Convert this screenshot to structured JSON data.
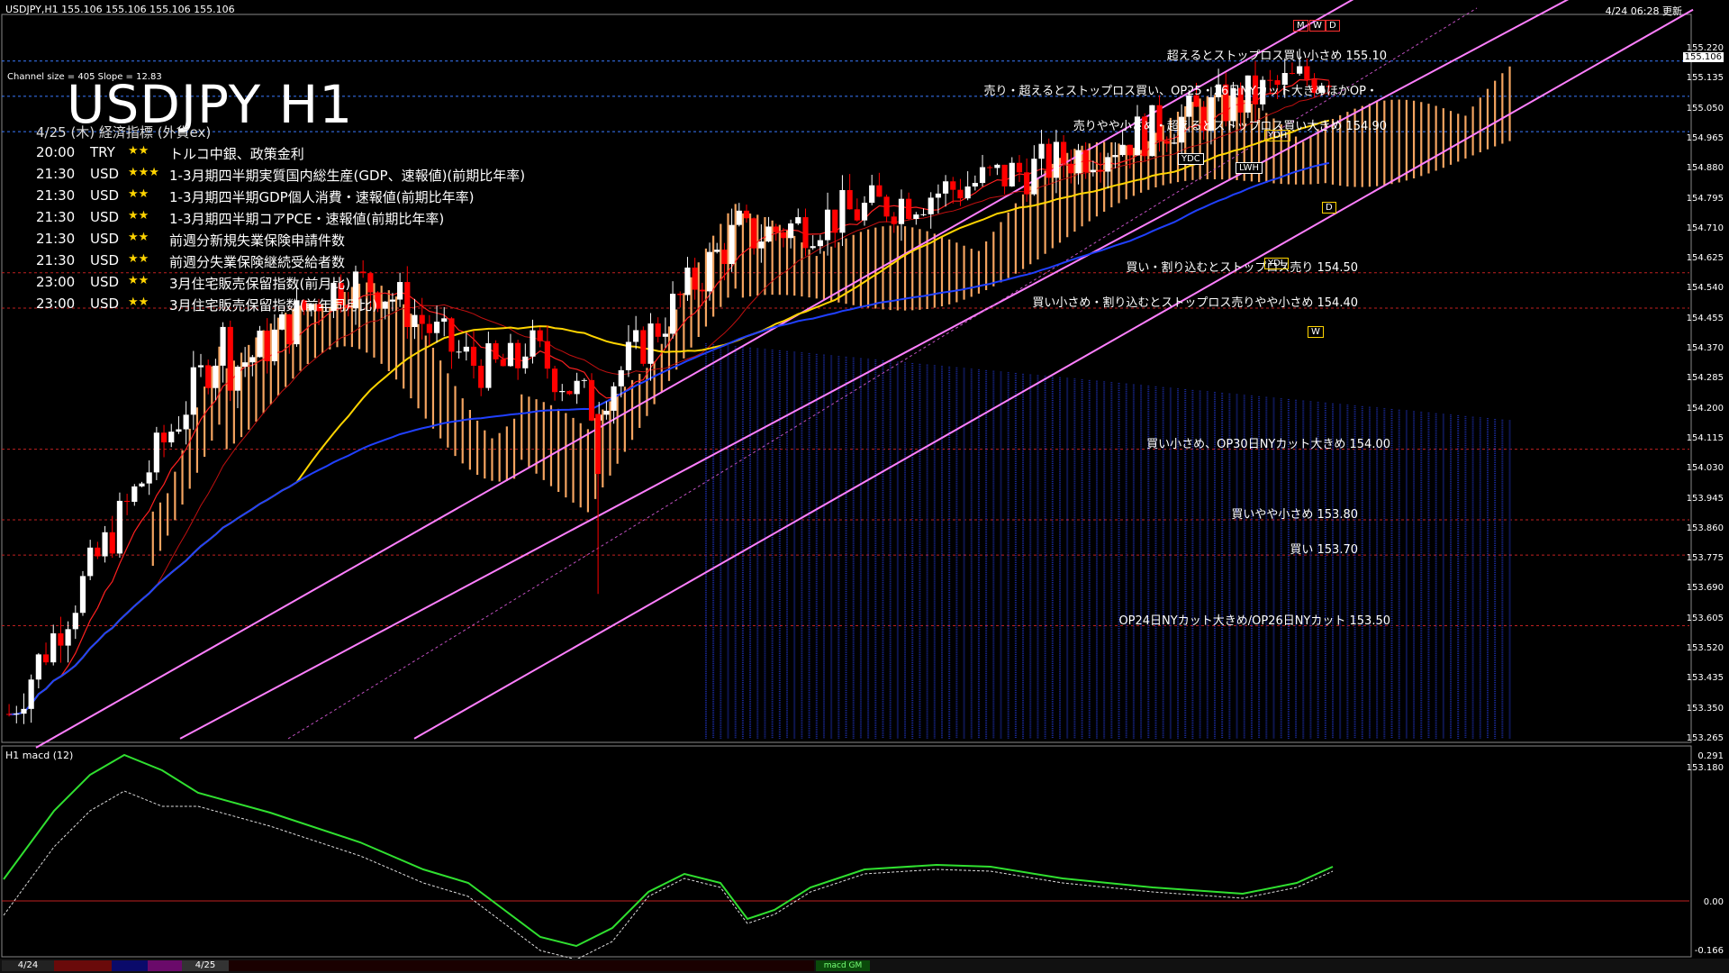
{
  "header": {
    "symbol_info": "USDJPY,H1  155.106 155.106 155.106 155.106",
    "datetime": "4/24 06:28 更新",
    "title": "USDJPY H1",
    "channel_info": "Channel size = 405 Slope = 12.83",
    "current_price": "155.106"
  },
  "calendar": {
    "header": "4/25 (木) 経済指標 (外貨ex)",
    "events": [
      {
        "time": "20:00",
        "currency": "TRY",
        "stars": "★★",
        "name": "トルコ中銀、政策金利"
      },
      {
        "time": "21:30",
        "currency": "USD",
        "stars": "★★★",
        "name": "1-3月期四半期実質国内総生産(GDP、速報値)(前期比年率)"
      },
      {
        "time": "21:30",
        "currency": "USD",
        "stars": "★★",
        "name": "1-3月期四半期GDP個人消費・速報値(前期比年率)"
      },
      {
        "time": "21:30",
        "currency": "USD",
        "stars": "★★",
        "name": "1-3月期四半期コアPCE・速報値(前期比年率)"
      },
      {
        "time": "21:30",
        "currency": "USD",
        "stars": "★★",
        "name": "前週分新規失業保険申請件数"
      },
      {
        "time": "21:30",
        "currency": "USD",
        "stars": "★★",
        "name": "前週分失業保険継続受給者数"
      },
      {
        "time": "23:00",
        "currency": "USD",
        "stars": "★★",
        "name": "3月住宅販売保留指数(前月比)"
      },
      {
        "time": "23:00",
        "currency": "USD",
        "stars": "★★",
        "name": "3月住宅販売保留指数(前年同月比)"
      }
    ]
  },
  "annotations": [
    {
      "text": "超えるとストップロス買い小さめ 155.10",
      "price": 155.1
    },
    {
      "text": "売り・超えるとストップロス買い、OP25・26日NYカット大きめほかOP・",
      "price": 155.0
    },
    {
      "text": "売りやや小さめ・超えるとストップロス買い大きめ 154.90",
      "price": 154.9
    },
    {
      "text": "買い・割り込むとストップロス売り 154.50",
      "price": 154.5
    },
    {
      "text": "買い小さめ・割り込むとストップロス売りやや小さめ 154.40",
      "price": 154.4
    },
    {
      "text": "買い小さめ、OP30日NYカット大きめ 154.00",
      "price": 154.0
    },
    {
      "text": "買いやや小さめ 153.80",
      "price": 153.8
    },
    {
      "text": "買い 153.70",
      "price": 153.7
    },
    {
      "text": "OP24日NYカット大きめ/OP26日NYカット 153.50",
      "price": 153.5
    }
  ],
  "price_axis": [
    "155.220",
    "155.135",
    "155.050",
    "154.965",
    "154.880",
    "154.795",
    "154.710",
    "154.625",
    "154.540",
    "154.455",
    "154.370",
    "154.285",
    "154.200",
    "154.115",
    "154.030",
    "153.945",
    "153.860",
    "153.775",
    "153.690",
    "153.605",
    "153.520",
    "153.435",
    "153.350",
    "153.265",
    "153.180"
  ],
  "level_boxes": [
    "M",
    "W",
    "D",
    "YDH",
    "YDC",
    "LWH",
    "YDL",
    "D",
    "W"
  ],
  "macd": {
    "title": "H1  macd (12)",
    "axis": [
      "0.291",
      "0.00",
      "-0.166"
    ]
  },
  "bottom_bar": {
    "labels": [
      "4/24",
      "4/25"
    ],
    "tab": "macd GM"
  },
  "colors": {
    "background": "#000000",
    "bull": "#ffffff",
    "bear": "#ff0000",
    "cloud_bull": "#f4a460",
    "cloud_bear": "#1a2a9a",
    "ma_fast": "#ff2020",
    "ma_mid": "#ffd400",
    "ma_slow": "#2040ff",
    "channel": "#ff7fff",
    "macd": "#30e030"
  }
}
